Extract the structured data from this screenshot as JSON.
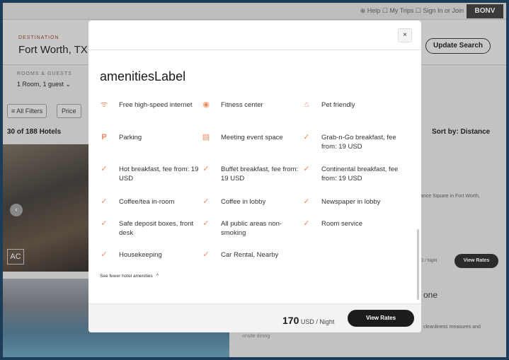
{
  "background": {
    "top_links": "⊕ Help  ☐ My Trips  ☐ Sign In or Join",
    "brand": "BONV",
    "destination_label": "DESTINATION",
    "destination_value": "Fort Worth, TX,",
    "update_search": "Update Search",
    "rooms_label": "ROOMS & GUESTS",
    "rooms_value": "1 Room, 1 guest ⌄",
    "filters_label": "≡ All Filters",
    "price_label": "Price",
    "hotel_count": "30 of 188 Hotels",
    "sort_label": "Sort by: Distance",
    "ac_badge": "AC",
    "card1_text": "ance Square in Fort Worth,",
    "card1_price_suffix": "D / Night",
    "card1_view_rates": "View Rates",
    "card2_title": "one",
    "card2_text": "cleanliness measures and",
    "onsite_text": "onsite dining"
  },
  "modal": {
    "close": "×",
    "title": "amenitiesLabel",
    "amenities": [
      {
        "icon": "wifi-icon",
        "glyph": "ᯤ",
        "label": "Free high-speed internet"
      },
      {
        "icon": "fitness-icon",
        "glyph": "◉",
        "label": "Fitness center"
      },
      {
        "icon": "pet-icon",
        "glyph": "⌂",
        "label": "Pet friendly"
      },
      {
        "icon": "parking-icon",
        "glyph": "P",
        "label": "Parking"
      },
      {
        "icon": "meeting-icon",
        "glyph": "▤",
        "label": "Meeting event space"
      },
      {
        "icon": "check-icon",
        "glyph": "✓",
        "label": "Grab-n-Go breakfast, fee from: 19 USD"
      },
      {
        "icon": "check-icon",
        "glyph": "✓",
        "label": "Hot breakfast, fee from: 19 USD"
      },
      {
        "icon": "check-icon",
        "glyph": "✓",
        "label": "Buffet breakfast, fee from: 19 USD"
      },
      {
        "icon": "check-icon",
        "glyph": "✓",
        "label": "Continental breakfast, fee from: 19 USD"
      },
      {
        "icon": "check-icon",
        "glyph": "✓",
        "label": "Coffee/tea in-room"
      },
      {
        "icon": "check-icon",
        "glyph": "✓",
        "label": "Coffee in lobby"
      },
      {
        "icon": "check-icon",
        "glyph": "✓",
        "label": "Newspaper in lobby"
      },
      {
        "icon": "check-icon",
        "glyph": "✓",
        "label": "Safe deposit boxes, front desk"
      },
      {
        "icon": "check-icon",
        "glyph": "✓",
        "label": "All public areas non-smoking"
      },
      {
        "icon": "check-icon",
        "glyph": "✓",
        "label": "Room service"
      },
      {
        "icon": "check-icon",
        "glyph": "✓",
        "label": "Housekeeping"
      },
      {
        "icon": "check-icon",
        "glyph": "✓",
        "label": "Car Rental, Nearby"
      }
    ],
    "see_fewer": "See fewer hotel amenities",
    "see_fewer_chevron": "^",
    "price_amount": "170",
    "price_suffix": "USD / Night",
    "view_rates": "View Rates",
    "accent_color": "#f08a5d"
  }
}
